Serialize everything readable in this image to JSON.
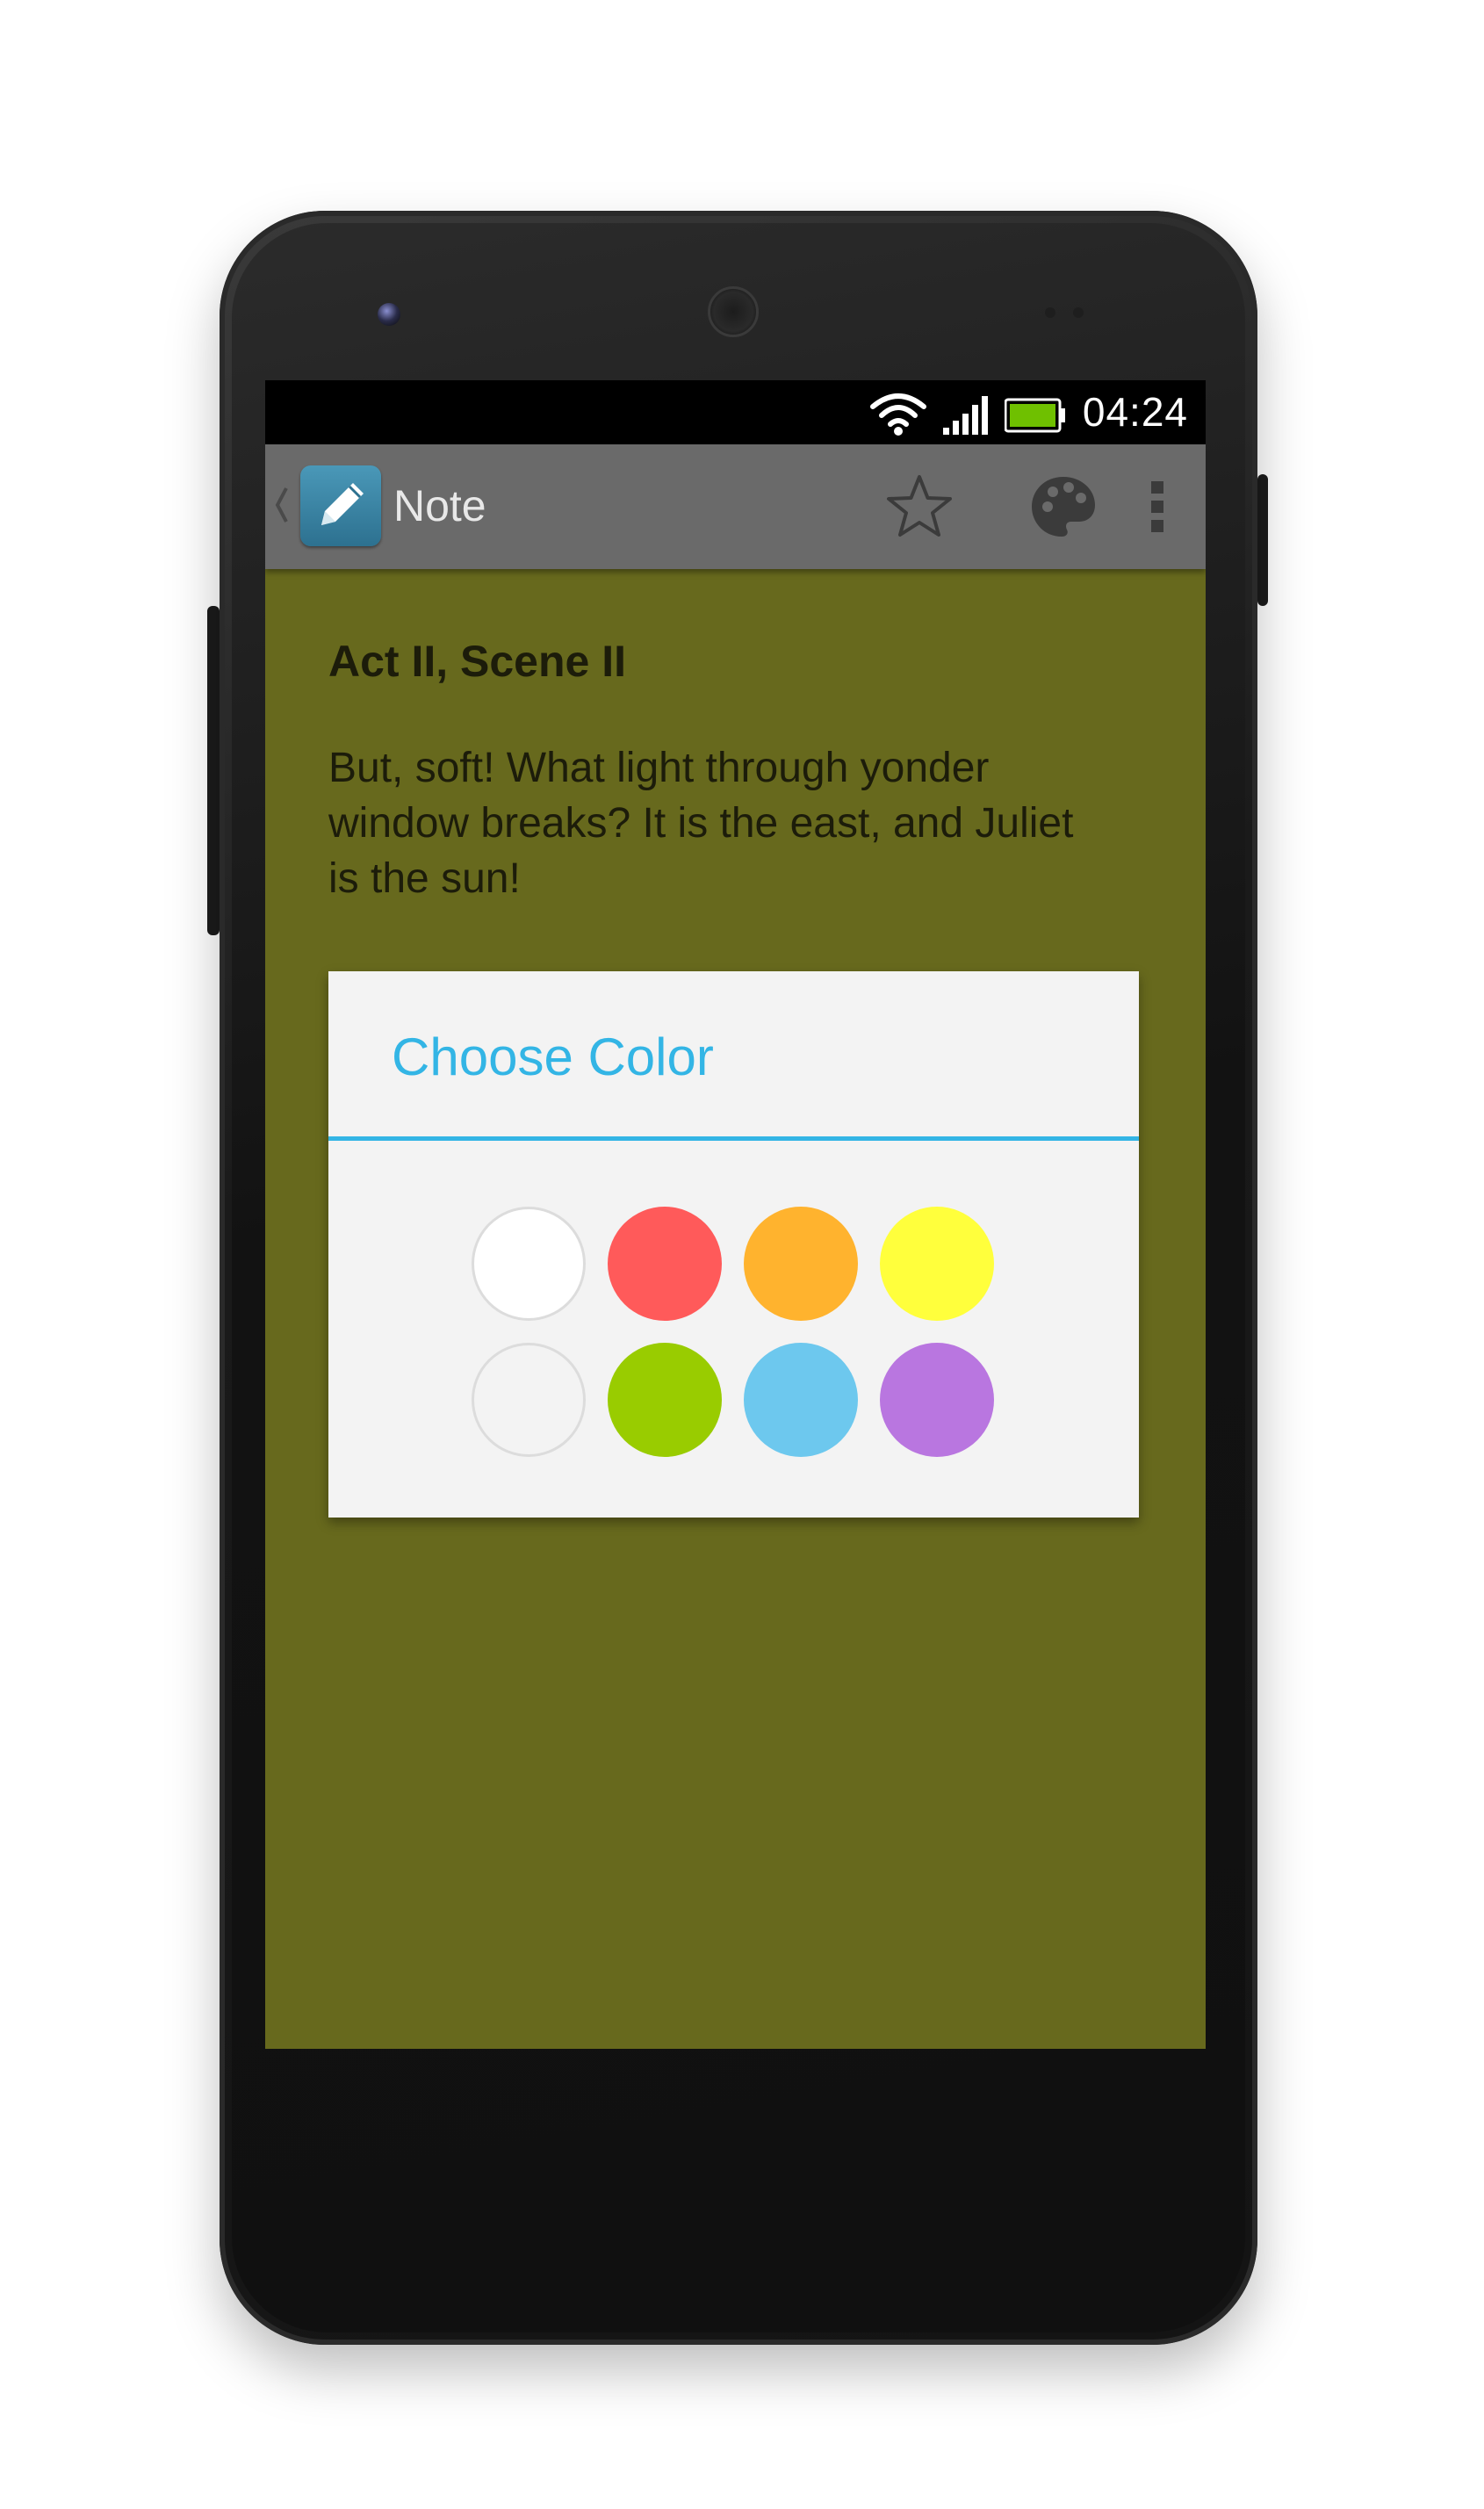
{
  "status_bar": {
    "time": "04:24",
    "icons": [
      "wifi-icon",
      "signal-icon",
      "battery-icon"
    ],
    "battery_color": "#6fc000"
  },
  "action_bar": {
    "up_icon": "chevron-left-icon",
    "app_icon": "pencil-icon",
    "title": "Note",
    "actions": [
      "star-icon",
      "palette-icon",
      "overflow-menu-icon"
    ]
  },
  "note": {
    "title": "Act II, Scene II",
    "body": "But, soft! What light through yonder window breaks? It is the east, and Juliet is the sun!",
    "background_color": "#67691d"
  },
  "dialog": {
    "title": "Choose Color",
    "accent_color": "#33b5e5",
    "swatches": [
      {
        "name": "white",
        "color": "#ffffff"
      },
      {
        "name": "red",
        "color": "#ff5a5a"
      },
      {
        "name": "orange",
        "color": "#ffb32e"
      },
      {
        "name": "yellow",
        "color": "#ffff3c"
      },
      {
        "name": "light-gray",
        "color": "#f3f3f3"
      },
      {
        "name": "green",
        "color": "#99cc00"
      },
      {
        "name": "blue",
        "color": "#6dc8ee"
      },
      {
        "name": "purple",
        "color": "#b976e0"
      }
    ]
  }
}
